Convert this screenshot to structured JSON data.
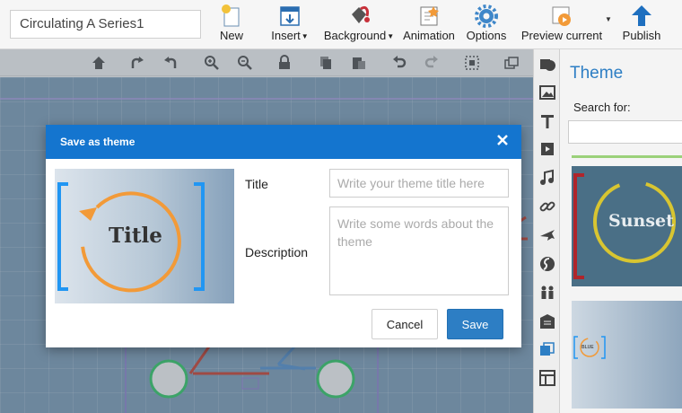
{
  "document": {
    "title": "Circulating A Series1"
  },
  "toolbar": {
    "new": "New",
    "insert": "Insert",
    "background": "Background",
    "animation": "Animation",
    "options": "Options",
    "preview": "Preview current",
    "publish": "Publish"
  },
  "panel": {
    "title": "Theme",
    "search_label": "Search for:",
    "themes": [
      {
        "label": "Sunset"
      },
      {
        "label": "BLUE"
      }
    ]
  },
  "modal": {
    "title": "Save as theme",
    "preview_label": "Title",
    "title_label": "Title",
    "title_placeholder": "Write your theme title here",
    "description_label": "Description",
    "description_placeholder": "Write some words about the theme",
    "cancel_label": "Cancel",
    "save_label": "Save"
  },
  "colors": {
    "accent": "#1475cf",
    "save_button": "#2d7ec4",
    "preview_arc": "#f29a38",
    "preview_bracket": "#2196f3",
    "sunset_bracket": "#b0252b",
    "sunset_arc": "#d8c531"
  }
}
